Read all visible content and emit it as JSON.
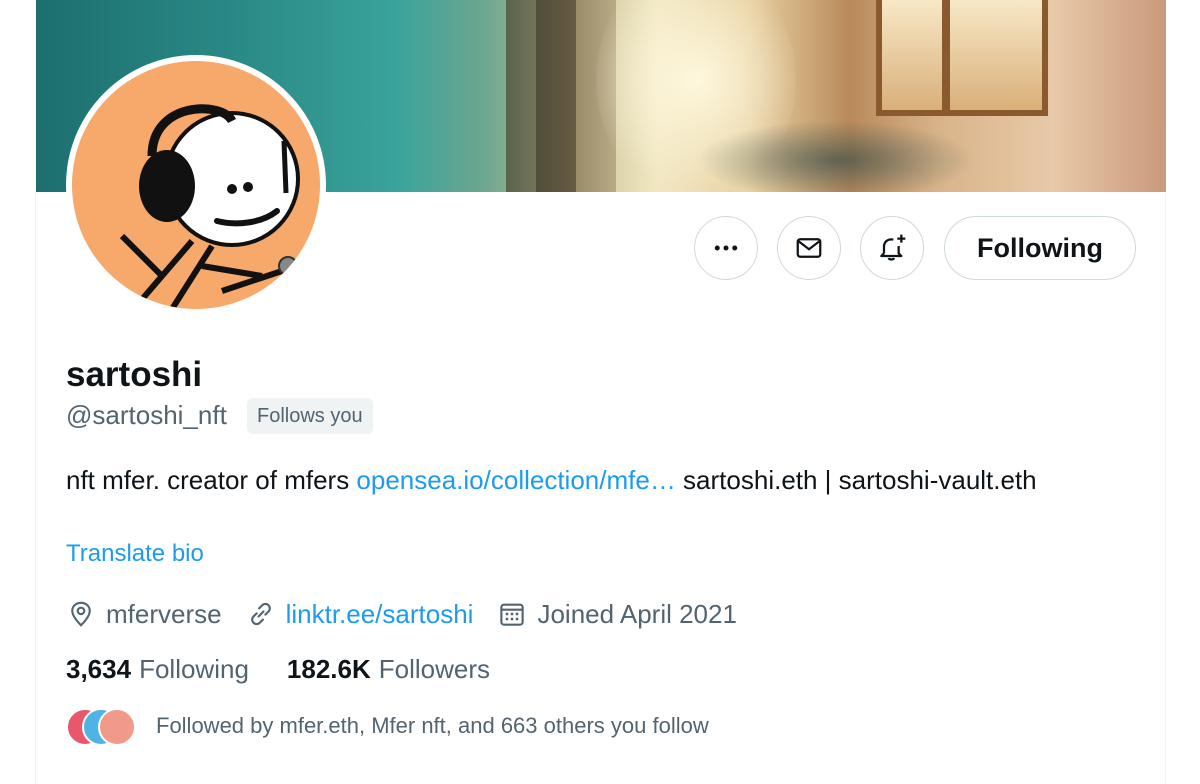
{
  "profile": {
    "display_name": "sartoshi",
    "handle": "@sartoshi_nft",
    "follows_you_badge": "Follows you",
    "bio_text_before": "nft mfer. creator of mfers ",
    "bio_link": "opensea.io/collection/mfe…",
    "bio_text_after": " sartoshi.eth | sartoshi-vault.eth",
    "translate_label": "Translate bio"
  },
  "actions": {
    "more_icon": "more-horizontal-icon",
    "message_icon": "mail-icon",
    "notify_icon": "bell-plus-icon",
    "follow_label": "Following"
  },
  "meta": {
    "location": "mferverse",
    "website": "linktr.ee/sartoshi",
    "joined": "Joined April 2021"
  },
  "stats": {
    "following_count": "3,634",
    "following_label": "Following",
    "followers_count": "182.6K",
    "followers_label": "Followers"
  },
  "followed_by": {
    "text": "Followed by mfer.eth, Mfer nft, and 663 others you follow"
  },
  "colors": {
    "accent": "#1d9bf0",
    "secondary_text": "#536471",
    "avatar_bg": "#f7a86b"
  }
}
